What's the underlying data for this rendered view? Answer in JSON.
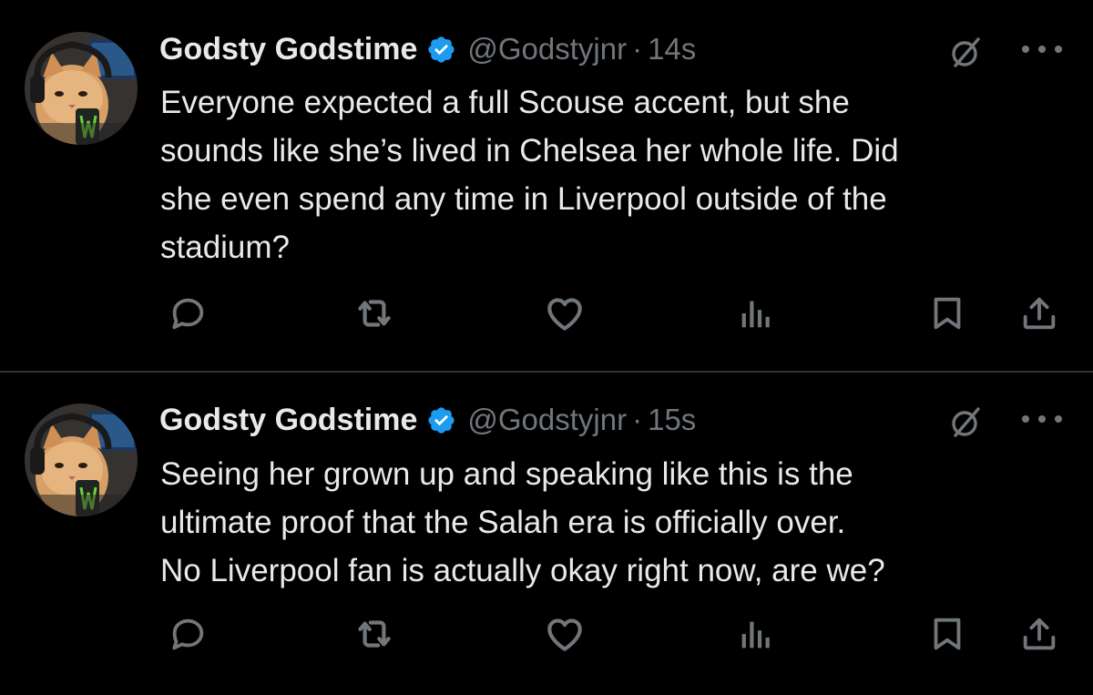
{
  "tweets": [
    {
      "name": "Godsty Godstime",
      "handle": "@Godstyjnr",
      "separator": "·",
      "time": "14s",
      "text": "Everyone expected a full Scouse accent, but she\nsounds like she’s lived in Chelsea her whole life. Did\nshe even spend any time in Liverpool outside of the\nstadium?",
      "verified": true
    },
    {
      "name": "Godsty Godstime",
      "handle": "@Godstyjnr",
      "separator": "·",
      "time": "15s",
      "text": "Seeing her grown up and speaking like this is the\nultimate proof that the Salah era is officially over.\nNo Liverpool fan is actually okay right now, are we?",
      "verified": true
    }
  ],
  "icons": {
    "avatar": "cat-avatar",
    "verified": "verified-badge-icon",
    "grok": "grok-icon",
    "more": "more-icon",
    "actions": [
      "reply-icon",
      "retweet-icon",
      "like-icon",
      "views-icon",
      "bookmark-icon",
      "share-icon"
    ]
  },
  "colors": {
    "background": "#000000",
    "text": "#e7e9ea",
    "secondary": "#71767b",
    "verified": "#1d9bf0",
    "divider": "#2f3336"
  }
}
